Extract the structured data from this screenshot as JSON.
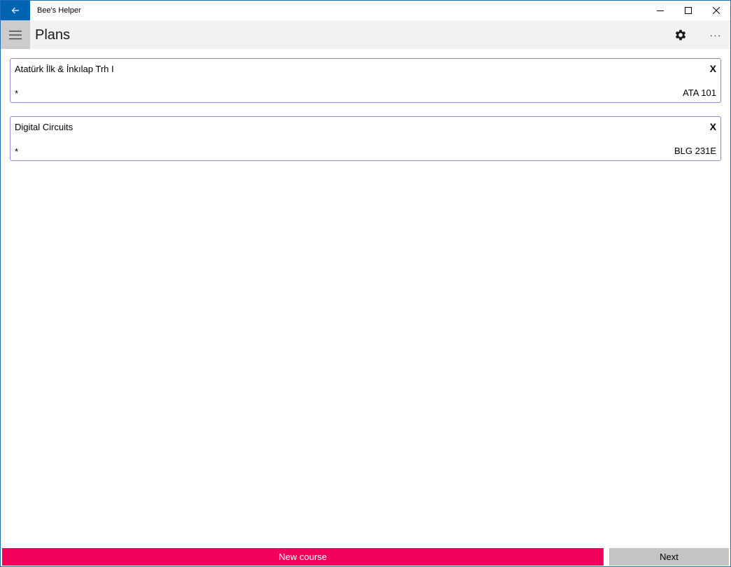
{
  "window": {
    "app_title": "Bee's Helper",
    "accent_color": "#0063b1"
  },
  "icons": {
    "back": "back-arrow-icon",
    "minimize": "minimize-icon",
    "maximize": "maximize-icon",
    "close": "close-icon",
    "menu": "hamburger-menu-icon",
    "settings": "gear-icon",
    "more": "more-ellipsis-icon"
  },
  "header": {
    "page_title": "Plans",
    "more_label": "···"
  },
  "courses": [
    {
      "name": "Atatürk İlk & İnkılap Trh I",
      "remove_label": "X",
      "marker": "*",
      "code": "ATA 101"
    },
    {
      "name": "Digital Circuits",
      "remove_label": "X",
      "marker": "*",
      "code": "BLG 231E"
    }
  ],
  "footer": {
    "new_course_label": "New course",
    "next_label": "Next",
    "new_course_color": "#f0005a",
    "next_color": "#c4c4c4"
  }
}
